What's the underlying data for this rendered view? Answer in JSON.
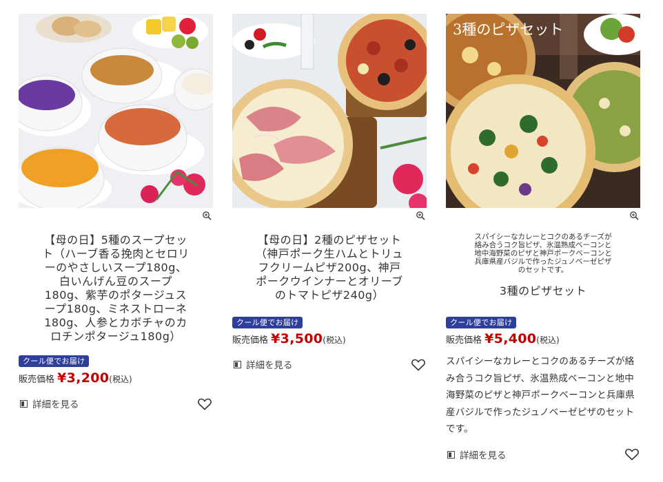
{
  "products": [
    {
      "title": "【母の日】5種のスープセット（ハーブ香る挽肉とセロリーのやさしいスープ180g、白いんげん豆のスープ180g、紫芋のポタージュスープ180g、ミネストローネ180g、人参とカボチャのカロチンポタージュ180g）",
      "title_lines": [
        "【母の日】5種のスープセッ",
        "ト（ハーブ香る挽肉とセロリ",
        "ーのやさしいスープ180g、",
        "白いんげん豆のスープ",
        "180g、紫芋のポタージュス",
        "ープ180g、ミネストローネ",
        "180g、人参とカボチャのカ",
        "ロチンポタージュ180g）"
      ],
      "badge": "クール便でお届け",
      "price_label": "販売価格",
      "price": "¥3,200",
      "tax": "(税込)",
      "detail_label": "詳細を見る"
    },
    {
      "title": "【母の日】2種のピザセット（神戸ポーク生ハムとトリュフクリームピザ200g、神戸ポークウインナーとオリーブのトマトピザ240g）",
      "title_lines": [
        "【母の日】2種のピザセット",
        "（神戸ポーク生ハムとトリュ",
        "フクリームピザ200g、神戸",
        "ポークウインナーとオリーブ",
        "のトマトピザ240g）"
      ],
      "badge": "クール便でお届け",
      "price_label": "販売価格",
      "price": "¥3,500",
      "tax": "(税込)",
      "detail_label": "詳細を見る"
    },
    {
      "image_overlay_text": "3種のピザセット",
      "caption_lines": [
        "スパイシーなカレーとコクのあるチーズが",
        "絡み合うコク旨ピザ、氷温熟成ベーコンと",
        "地中海野菜のピザと神戸ポークベーコンと",
        "兵庫県産バジルで作ったジュノベーゼピザ",
        "のセットです。"
      ],
      "title": "3種のピザセット",
      "badge": "クール便でお届け",
      "price_label": "販売価格",
      "price": "¥5,400",
      "tax": "(税込)",
      "description_lines": [
        "スパイシーなカレーとコクのあるチーズが絡",
        "み合うコク旨ピザ、氷温熟成ベーコンと地中",
        "海野菜のピザと神戸ポークベーコンと兵庫県",
        "産バジルで作ったジュノベーゼピザのセット",
        "です。"
      ],
      "detail_label": "詳細を見る"
    }
  ],
  "colors": {
    "badge_bg": "#2e3f9b",
    "price": "#c00000",
    "text": "#333333"
  },
  "icons": {
    "zoom": "zoom-in-icon",
    "detail": "detail-page-icon",
    "favorite": "heart-outline-icon"
  }
}
